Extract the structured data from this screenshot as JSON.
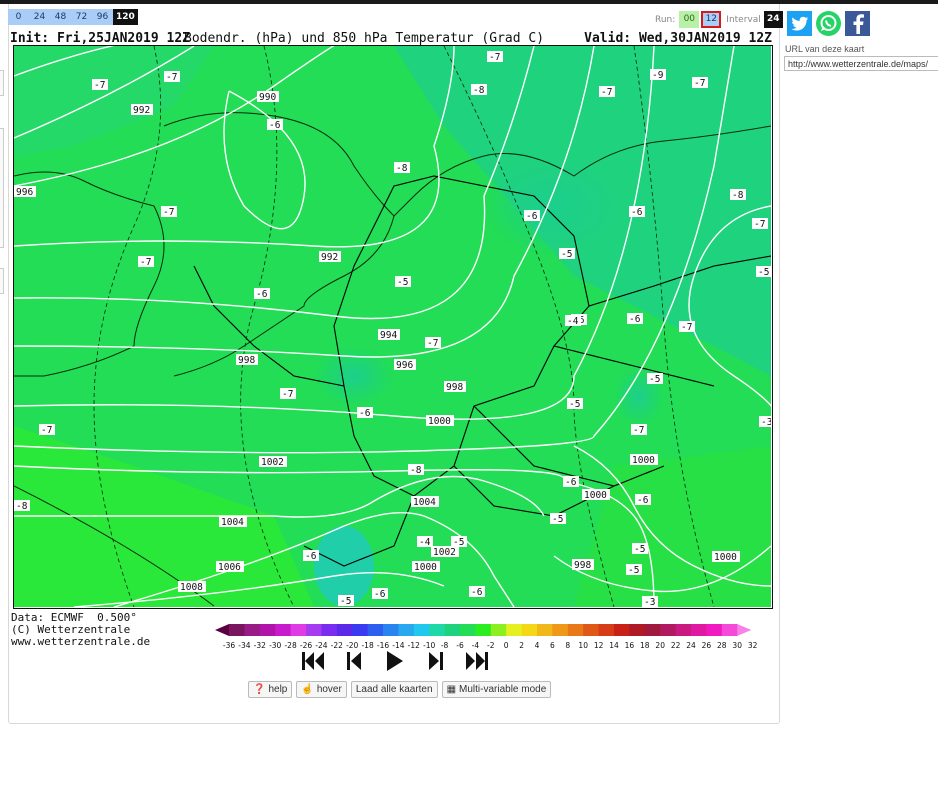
{
  "steps": [
    "0",
    "24",
    "48",
    "72",
    "96",
    "120"
  ],
  "active_step": "120",
  "run": {
    "label": "Run:",
    "options": [
      "00",
      "12"
    ],
    "selected": "12"
  },
  "interval": {
    "label": "Interval",
    "value": "24"
  },
  "map": {
    "init": "Init: Fri,25JAN2019 12Z",
    "title": "Bodendr. (hPa) und 850 hPa Temperatur (Grad C)",
    "valid": "Valid: Wed,30JAN2019 12Z",
    "pressure_labels": [
      "990",
      "992",
      "996",
      "992",
      "994",
      "996",
      "998",
      "998",
      "1000",
      "1002",
      "1000",
      "1000",
      "1004",
      "1004",
      "1002",
      "1006",
      "1000",
      "998",
      "1008",
      "1000"
    ],
    "temp_labels": [
      "-7",
      "-7",
      "-7",
      "-8",
      "-7",
      "-9",
      "-7",
      "-6",
      "-8",
      "-6",
      "-6",
      "-8",
      "-7",
      "-7",
      "-7",
      "-6",
      "-5",
      "-5",
      "-6",
      "-6",
      "-7",
      "-7",
      "-4",
      "-7",
      "-6",
      "-7",
      "-8",
      "-5",
      "-5",
      "-7",
      "-8",
      "-6",
      "-6",
      "-5",
      "-5",
      "-6",
      "-6",
      "-5",
      "-6",
      "-5",
      "-4",
      "-5",
      "-3",
      "-3",
      "-5"
    ],
    "colors": {
      "cold": "#1fd27e",
      "mid": "#22dd55",
      "warm": "#2aee22",
      "isobar": "#ffffff",
      "border": "#111111"
    }
  },
  "footer": {
    "data": "Data: ECMWF  0.500°",
    "copyright": "(C) Wetterzentrale",
    "site": "www.wetterzentrale.de"
  },
  "colorscale": {
    "ticks": [
      "-36",
      "-34",
      "-32",
      "-30",
      "-28",
      "-26",
      "-24",
      "-22",
      "-20",
      "-18",
      "-16",
      "-14",
      "-12",
      "-10",
      "-8",
      "-6",
      "-4",
      "-2",
      "0",
      "2",
      "4",
      "6",
      "8",
      "10",
      "12",
      "14",
      "16",
      "18",
      "20",
      "22",
      "24",
      "26",
      "28",
      "30",
      "32"
    ],
    "colors": [
      "#5a0040",
      "#7a1560",
      "#991c86",
      "#b014a8",
      "#c81ccc",
      "#e03ce6",
      "#a63cf0",
      "#7a2df0",
      "#5a2ae8",
      "#3a3af0",
      "#2e5ef0",
      "#2a84ef",
      "#28a8ef",
      "#20c8ef",
      "#1fd8a8",
      "#1fd27e",
      "#22dd55",
      "#2aee22",
      "#8cf020",
      "#e6f020",
      "#f4d818",
      "#f0b818",
      "#f09818",
      "#e87818",
      "#e05818",
      "#d63c18",
      "#c82218",
      "#b01a24",
      "#a01a40",
      "#b01a60",
      "#c81a80",
      "#e01aa0",
      "#f01ac0",
      "#f54ad8",
      "#f880e8"
    ]
  },
  "player": {
    "first_icon": "skip-first-icon",
    "prev_icon": "step-back-icon",
    "play_icon": "play-icon",
    "next_icon": "step-forward-icon",
    "last_icon": "skip-last-icon"
  },
  "buttons": {
    "help": "help",
    "hover": "hover",
    "load_all": "Laad alle kaarten",
    "multivar": "Multi-variable mode"
  },
  "share": {
    "twitter": "twitter-icon",
    "whatsapp": "whatsapp-icon",
    "facebook": "facebook-icon",
    "colors": {
      "twitter": "#1da1f2",
      "whatsapp": "#25d366",
      "facebook": "#3b5998"
    }
  },
  "url": {
    "label": "URL van deze kaart",
    "value": "http://www.wetterzentrale.de/maps/"
  }
}
